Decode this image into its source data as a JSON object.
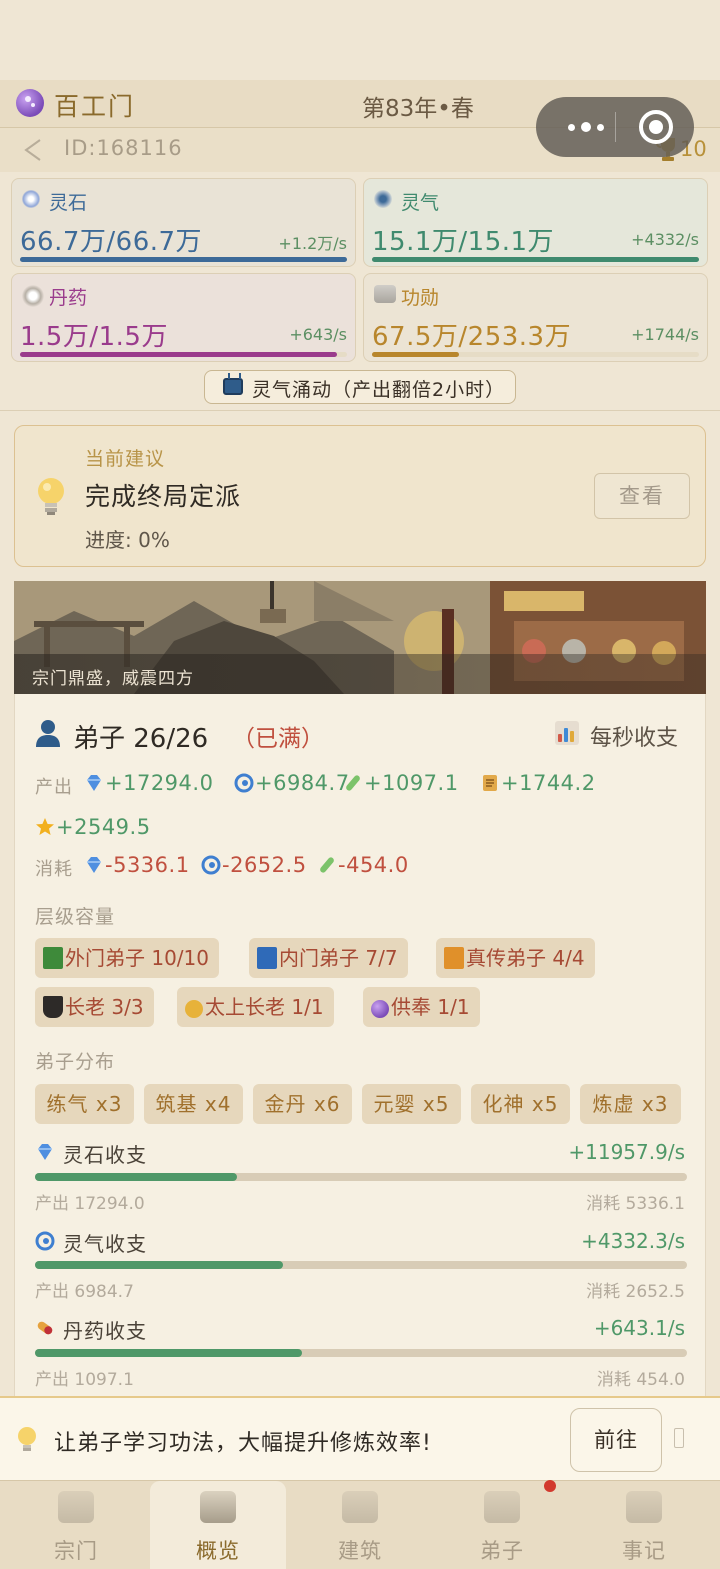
{
  "header": {
    "sect_name": "百工门",
    "date": "第83年•春",
    "id_text": "ID:168116",
    "trophy_count": "10"
  },
  "resources": [
    {
      "name": "灵石",
      "value": "66.7万/66.7万",
      "rate": "+1.2万/s",
      "fill": 1.0,
      "color": "#3d6a98",
      "name_color": "#3d6a98"
    },
    {
      "name": "灵气",
      "value": "15.1万/15.1万",
      "rate": "+4332/s",
      "fill": 1.0,
      "color": "#3f8a6e",
      "name_color": "#3f8a6e"
    },
    {
      "name": "丹药",
      "value": "1.5万/1.5万",
      "rate": "+643/s",
      "fill": 0.97,
      "color": "#9a3b8c",
      "name_color": "#9a3b8c"
    },
    {
      "name": "功勋",
      "value": "67.5万/253.3万",
      "rate": "+1744/s",
      "fill": 0.266,
      "color": "#b8862c",
      "name_color": "#b8862c"
    }
  ],
  "boost_label": "灵气涌动（产出翻倍2小时）",
  "suggestion": {
    "heading": "当前建议",
    "title": "完成终局定派",
    "progress": "进度: 0%",
    "button": "查看"
  },
  "banner_caption": "宗门鼎盛，威震四方",
  "disciples": {
    "title": "弟子 26/26",
    "full_label": "（已满）",
    "per_sec_label": "每秒收支",
    "output_label": "产出",
    "consume_label": "消耗",
    "output": [
      "+17294.0",
      "+6984.7",
      "+1097.1",
      "+1744.2",
      "+2549.5"
    ],
    "consume": [
      "-5336.1",
      "-2652.5",
      "-454.0"
    ],
    "tier_label": "层级容量",
    "tiers": [
      "外门弟子 10/10",
      "内门弟子 7/7",
      "真传弟子 4/4",
      "长老 3/3",
      "太上长老 1/1",
      "供奉 1/1"
    ],
    "dist_label": "弟子分布",
    "realms": [
      "练气 x3",
      "筑基 x4",
      "金丹 x6",
      "元婴 x5",
      "化神 x5",
      "炼虚 x3"
    ],
    "flows": [
      {
        "name": "灵石收支",
        "rate": "+11957.9/s",
        "in": "产出 17294.0",
        "out": "消耗 5336.1",
        "fill": 0.31
      },
      {
        "name": "灵气收支",
        "rate": "+4332.3/s",
        "in": "产出 6984.7",
        "out": "消耗 2652.5",
        "fill": 0.38
      },
      {
        "name": "丹药收支",
        "rate": "+643.1/s",
        "in": "产出 1097.1",
        "out": "消耗 454.0",
        "fill": 0.41
      }
    ]
  },
  "tip": {
    "text": "让弟子学习功法，大幅提升修炼效率!",
    "button": "前往"
  },
  "tabs": [
    "宗门",
    "概览",
    "建筑",
    "弟子",
    "事记"
  ],
  "active_tab": "概览"
}
